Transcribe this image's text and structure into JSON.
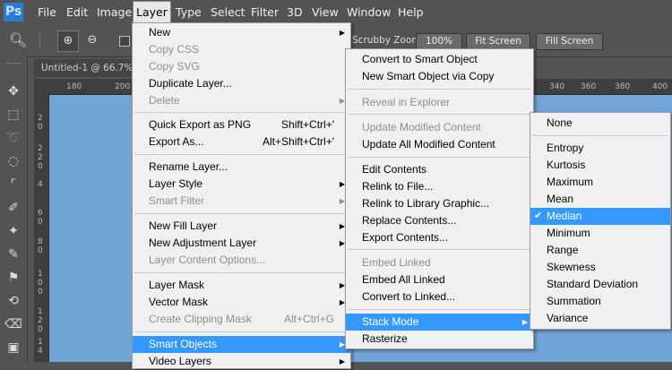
{
  "app": {
    "logo": "Ps"
  },
  "menubar": [
    "File",
    "Edit",
    "Image",
    "Layer",
    "Type",
    "Select",
    "Filter",
    "3D",
    "View",
    "Window",
    "Help"
  ],
  "options": {
    "scrubby": "Scrubby Zoom",
    "zoom": "100%",
    "fit": "Fit Screen",
    "fill": "Fill Screen"
  },
  "document": {
    "tab": "Untitled-1 @ 66.7%",
    "ruler_top": [
      "180",
      "200",
      "340",
      "360",
      "380",
      "400"
    ],
    "ruler_left": [
      "2",
      "0",
      "2",
      "2",
      "0",
      "4",
      "6",
      "0",
      "8",
      "0",
      "1",
      "0",
      "0",
      "1",
      "2",
      "0",
      "1",
      "4"
    ]
  },
  "layer_menu": [
    {
      "label": "New",
      "arrow": true
    },
    {
      "label": "Copy CSS",
      "disabled": true
    },
    {
      "label": "Copy SVG",
      "disabled": true
    },
    {
      "label": "Duplicate Layer..."
    },
    {
      "label": "Delete",
      "arrow": true,
      "disabled": true
    },
    {
      "label": "Quick Export as PNG",
      "shortcut": "Shift+Ctrl+'"
    },
    {
      "label": "Export As...",
      "shortcut": "Alt+Shift+Ctrl+'"
    },
    {
      "label": "Rename Layer..."
    },
    {
      "label": "Layer Style",
      "arrow": true
    },
    {
      "label": "Smart Filter",
      "arrow": true,
      "disabled": true
    },
    {
      "label": "New Fill Layer",
      "arrow": true
    },
    {
      "label": "New Adjustment Layer",
      "arrow": true
    },
    {
      "label": "Layer Content Options...",
      "disabled": true
    },
    {
      "label": "Layer Mask",
      "arrow": true
    },
    {
      "label": "Vector Mask",
      "arrow": true
    },
    {
      "label": "Create Clipping Mask",
      "shortcut": "Alt+Ctrl+G",
      "disabled": true
    },
    {
      "label": "Smart Objects",
      "arrow": true,
      "highlighted": true
    },
    {
      "label": "Video Layers",
      "arrow": true
    }
  ],
  "smart_objects_menu": [
    {
      "label": "Convert to Smart Object"
    },
    {
      "label": "New Smart Object via Copy"
    },
    {
      "label": "Reveal in Explorer",
      "disabled": true
    },
    {
      "label": "Update Modified Content",
      "disabled": true
    },
    {
      "label": "Update All Modified Content"
    },
    {
      "label": "Edit Contents"
    },
    {
      "label": "Relink to File..."
    },
    {
      "label": "Relink to Library Graphic..."
    },
    {
      "label": "Replace Contents..."
    },
    {
      "label": "Export Contents..."
    },
    {
      "label": "Embed Linked",
      "disabled": true
    },
    {
      "label": "Embed All Linked"
    },
    {
      "label": "Convert to Linked..."
    },
    {
      "label": "Stack Mode",
      "arrow": true,
      "highlighted": true
    },
    {
      "label": "Rasterize"
    }
  ],
  "stack_mode_menu": [
    {
      "label": "None"
    },
    {
      "label": "Entropy"
    },
    {
      "label": "Kurtosis"
    },
    {
      "label": "Maximum"
    },
    {
      "label": "Mean"
    },
    {
      "label": "Median",
      "checked": true,
      "highlighted": true
    },
    {
      "label": "Minimum"
    },
    {
      "label": "Range"
    },
    {
      "label": "Skewness"
    },
    {
      "label": "Standard Deviation"
    },
    {
      "label": "Summation"
    },
    {
      "label": "Variance"
    }
  ],
  "colors": {
    "canvas": "#70a3d6",
    "highlight": "#3399ff",
    "chrome": "#535353"
  }
}
